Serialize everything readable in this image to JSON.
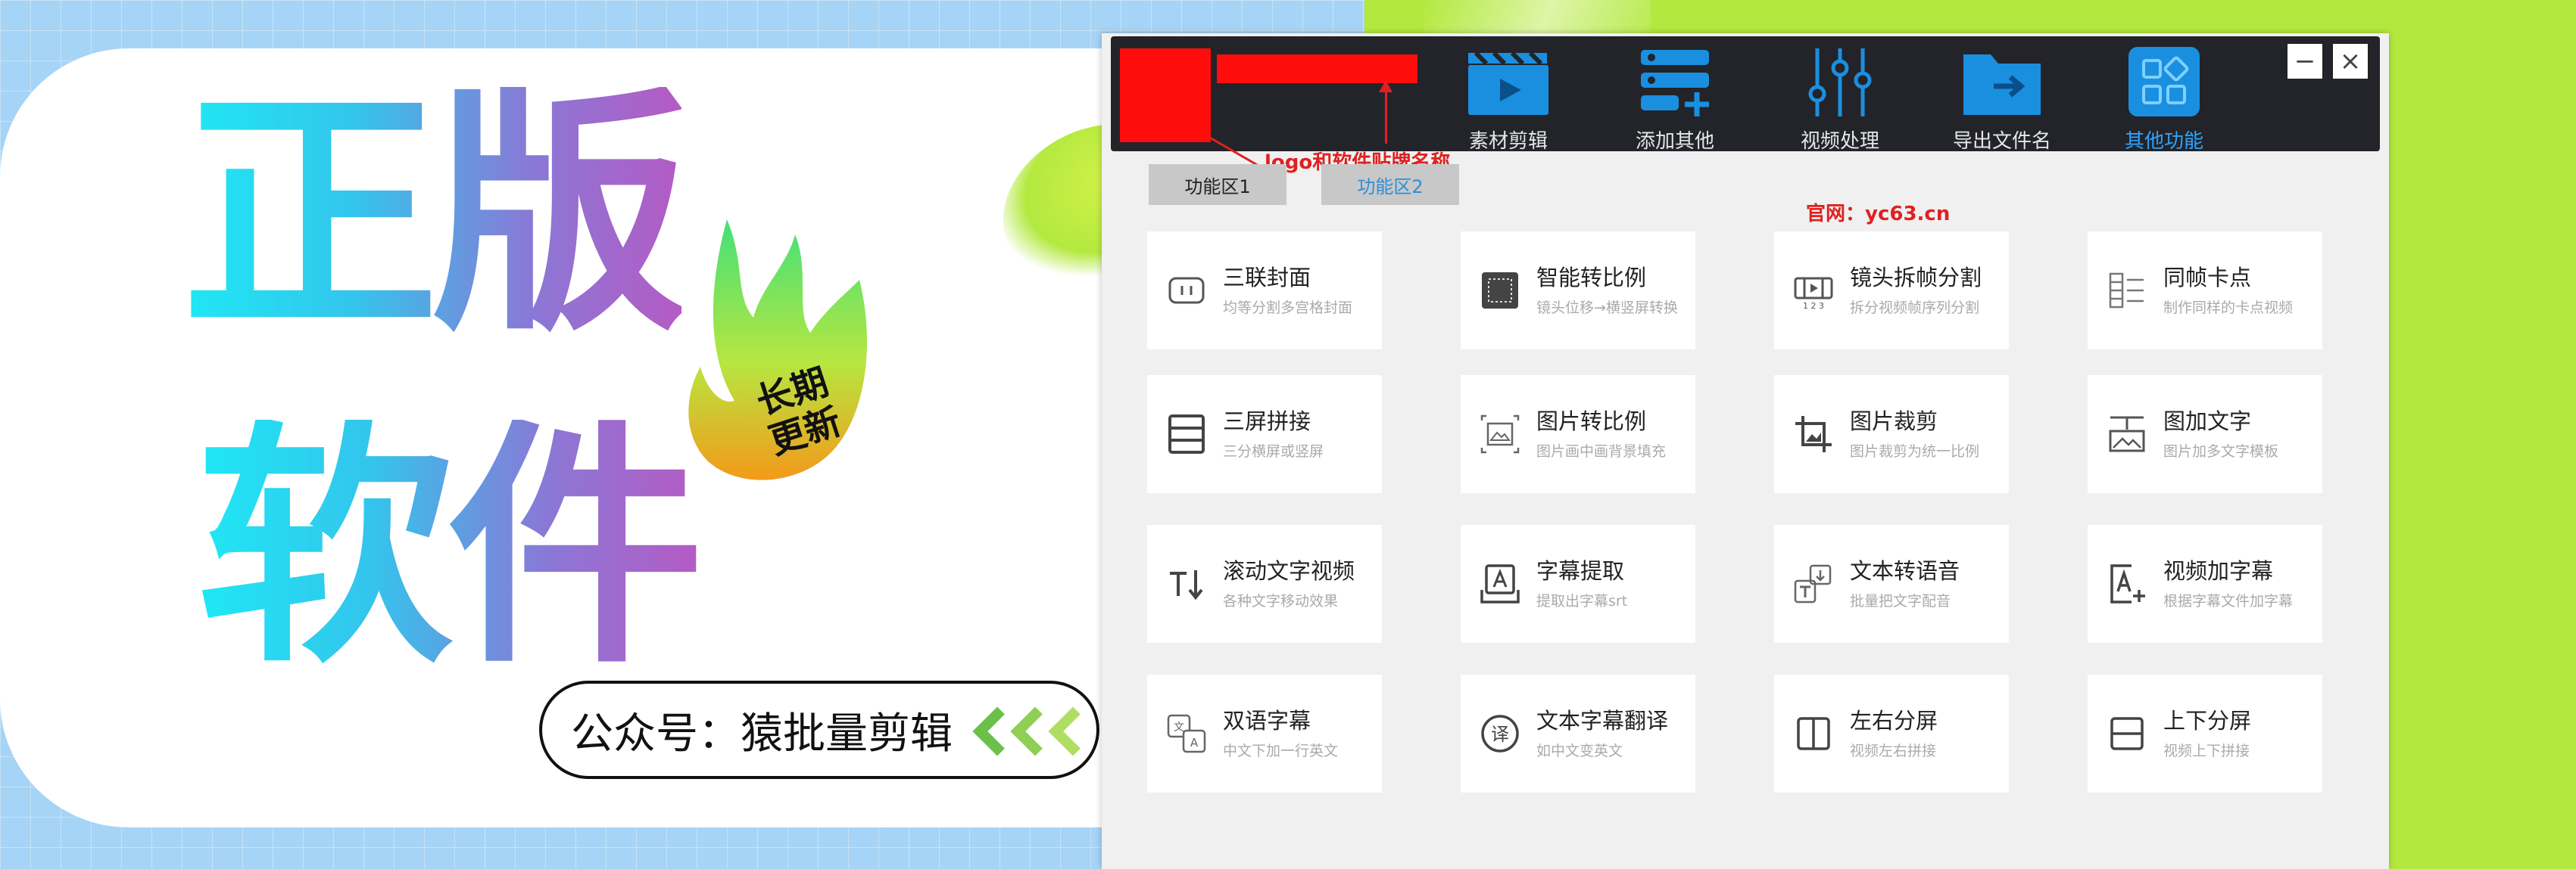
{
  "poster": {
    "title_line1": "正版",
    "title_line2": "软件",
    "badge_line1": "长期",
    "badge_line2": "更新",
    "account_label": "公众号：猿批量剪辑"
  },
  "window": {
    "logo_note": "logo和软件贴牌名称",
    "site_label": "官网：yc63.cn",
    "minimize_label": "−",
    "close_label": "×",
    "toolbar": [
      {
        "label": "素材剪辑",
        "icon": "clapperboard-icon"
      },
      {
        "label": "添加其他",
        "icon": "add-stack-icon"
      },
      {
        "label": "视频处理",
        "icon": "sliders-icon"
      },
      {
        "label": "导出文件名",
        "icon": "folder-export-icon"
      },
      {
        "label": "其他功能",
        "icon": "apps-icon",
        "active": true
      }
    ],
    "tabs": [
      {
        "label": "功能区1"
      },
      {
        "label": "功能区2",
        "active": true
      }
    ],
    "features": [
      {
        "title": "三联封面",
        "sub": "均等分割多宫格封面",
        "icon": "triple-cover-icon"
      },
      {
        "title": "智能转比例",
        "sub": "镜头位移→横竖屏转换",
        "icon": "smart-ratio-icon"
      },
      {
        "title": "镜头拆帧分割",
        "sub": "拆分视频帧序列分割",
        "icon": "frame-split-icon"
      },
      {
        "title": "同帧卡点",
        "sub": "制作同样的卡点视频",
        "icon": "beat-sync-icon"
      },
      {
        "title": "三屏拼接",
        "sub": "三分横屏或竖屏",
        "icon": "three-screen-icon"
      },
      {
        "title": "图片转比例",
        "sub": "图片画中画背景填充",
        "icon": "image-ratio-icon"
      },
      {
        "title": "图片裁剪",
        "sub": "图片裁剪为统一比例",
        "icon": "image-crop-icon"
      },
      {
        "title": "图加文字",
        "sub": "图片加多文字模板",
        "icon": "image-text-icon"
      },
      {
        "title": "滚动文字视频",
        "sub": "各种文字移动效果",
        "icon": "scroll-text-icon"
      },
      {
        "title": "字幕提取",
        "sub": "提取出字幕srt",
        "icon": "subtitle-extract-icon"
      },
      {
        "title": "文本转语音",
        "sub": "批量把文字配音",
        "icon": "text-to-speech-icon"
      },
      {
        "title": "视频加字幕",
        "sub": "根据字幕文件加字幕",
        "icon": "add-subtitle-icon"
      },
      {
        "title": "双语字幕",
        "sub": "中文下加一行英文",
        "icon": "bilingual-icon"
      },
      {
        "title": "文本字幕翻译",
        "sub": "如中文变英文",
        "icon": "translate-icon"
      },
      {
        "title": "左右分屏",
        "sub": "视频左右拼接",
        "icon": "split-lr-icon"
      },
      {
        "title": "上下分屏",
        "sub": "视频上下拼接",
        "icon": "split-tb-icon"
      }
    ]
  },
  "colors": {
    "accent_blue": "#1a8fe0",
    "active_label": "#2ea3ff",
    "annotation_red": "#e02020",
    "background_green": "#b3e93f",
    "background_blue": "#a6d4f6"
  }
}
